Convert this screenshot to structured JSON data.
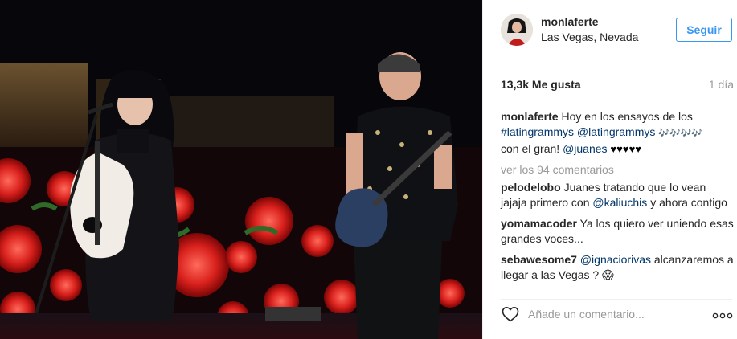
{
  "post": {
    "username": "monlaferte",
    "location": "Las Vegas, Nevada",
    "follow_label": "Seguir",
    "likes": "13,3k Me gusta",
    "time": "1 día"
  },
  "caption": {
    "user": "monlaferte",
    "text_1": "Hoy en los ensayos de los",
    "hashtag": "#latingrammys",
    "mention_1": "@latingrammys",
    "emoji_1": "🎶🎶🎶🎶",
    "text_2": "con el gran!",
    "mention_2": "@juanes",
    "hearts": "♥♥♥♥♥"
  },
  "view_all": "ver los 94 comentarios",
  "comments": [
    {
      "user": "pelodelobo",
      "text_a": "Juanes tratando que lo vean jajaja primero con",
      "mention": "@kaliuchis",
      "text_b": "y ahora contigo"
    },
    {
      "user": "yomamacoder",
      "text_a": "Ya los quiero ver uniendo esas grandes voces..."
    },
    {
      "user": "sebawesome7",
      "mention": "@ignaciorivas",
      "text_b": "alcanzaremos a llegar a las Vegas ?",
      "emoji": "😱"
    }
  ],
  "add_comment": {
    "placeholder": "Añade un comentario..."
  },
  "icons": {
    "like": "heart-outline-icon",
    "more": "more-options-icon"
  },
  "colors": {
    "accent": "#3897f0",
    "link": "#003569",
    "muted": "#999999"
  }
}
